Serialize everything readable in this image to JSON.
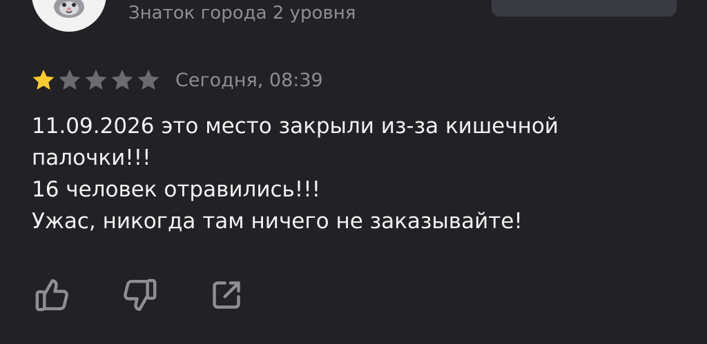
{
  "author": {
    "level": "Знаток города 2 уровня",
    "avatar_icon": "cat-avatar-icon"
  },
  "review": {
    "rating": 1,
    "max_rating": 5,
    "date": "Сегодня, 08:39",
    "lines": [
      "11.09.2026 это место закрыли из-за кишечной",
      "палочки!!!",
      "16 человек отравились!!!",
      "Ужас, никогда там ничего не заказывайте!"
    ]
  },
  "actions": {
    "like_icon": "thumbs-up-icon",
    "dislike_icon": "thumbs-down-icon",
    "share_icon": "share-icon"
  },
  "colors": {
    "background": "#222226",
    "star_active": "#fcc930",
    "star_inactive": "#6b6b70",
    "text_primary": "#f2f2f2",
    "text_secondary": "#8e8e93"
  }
}
